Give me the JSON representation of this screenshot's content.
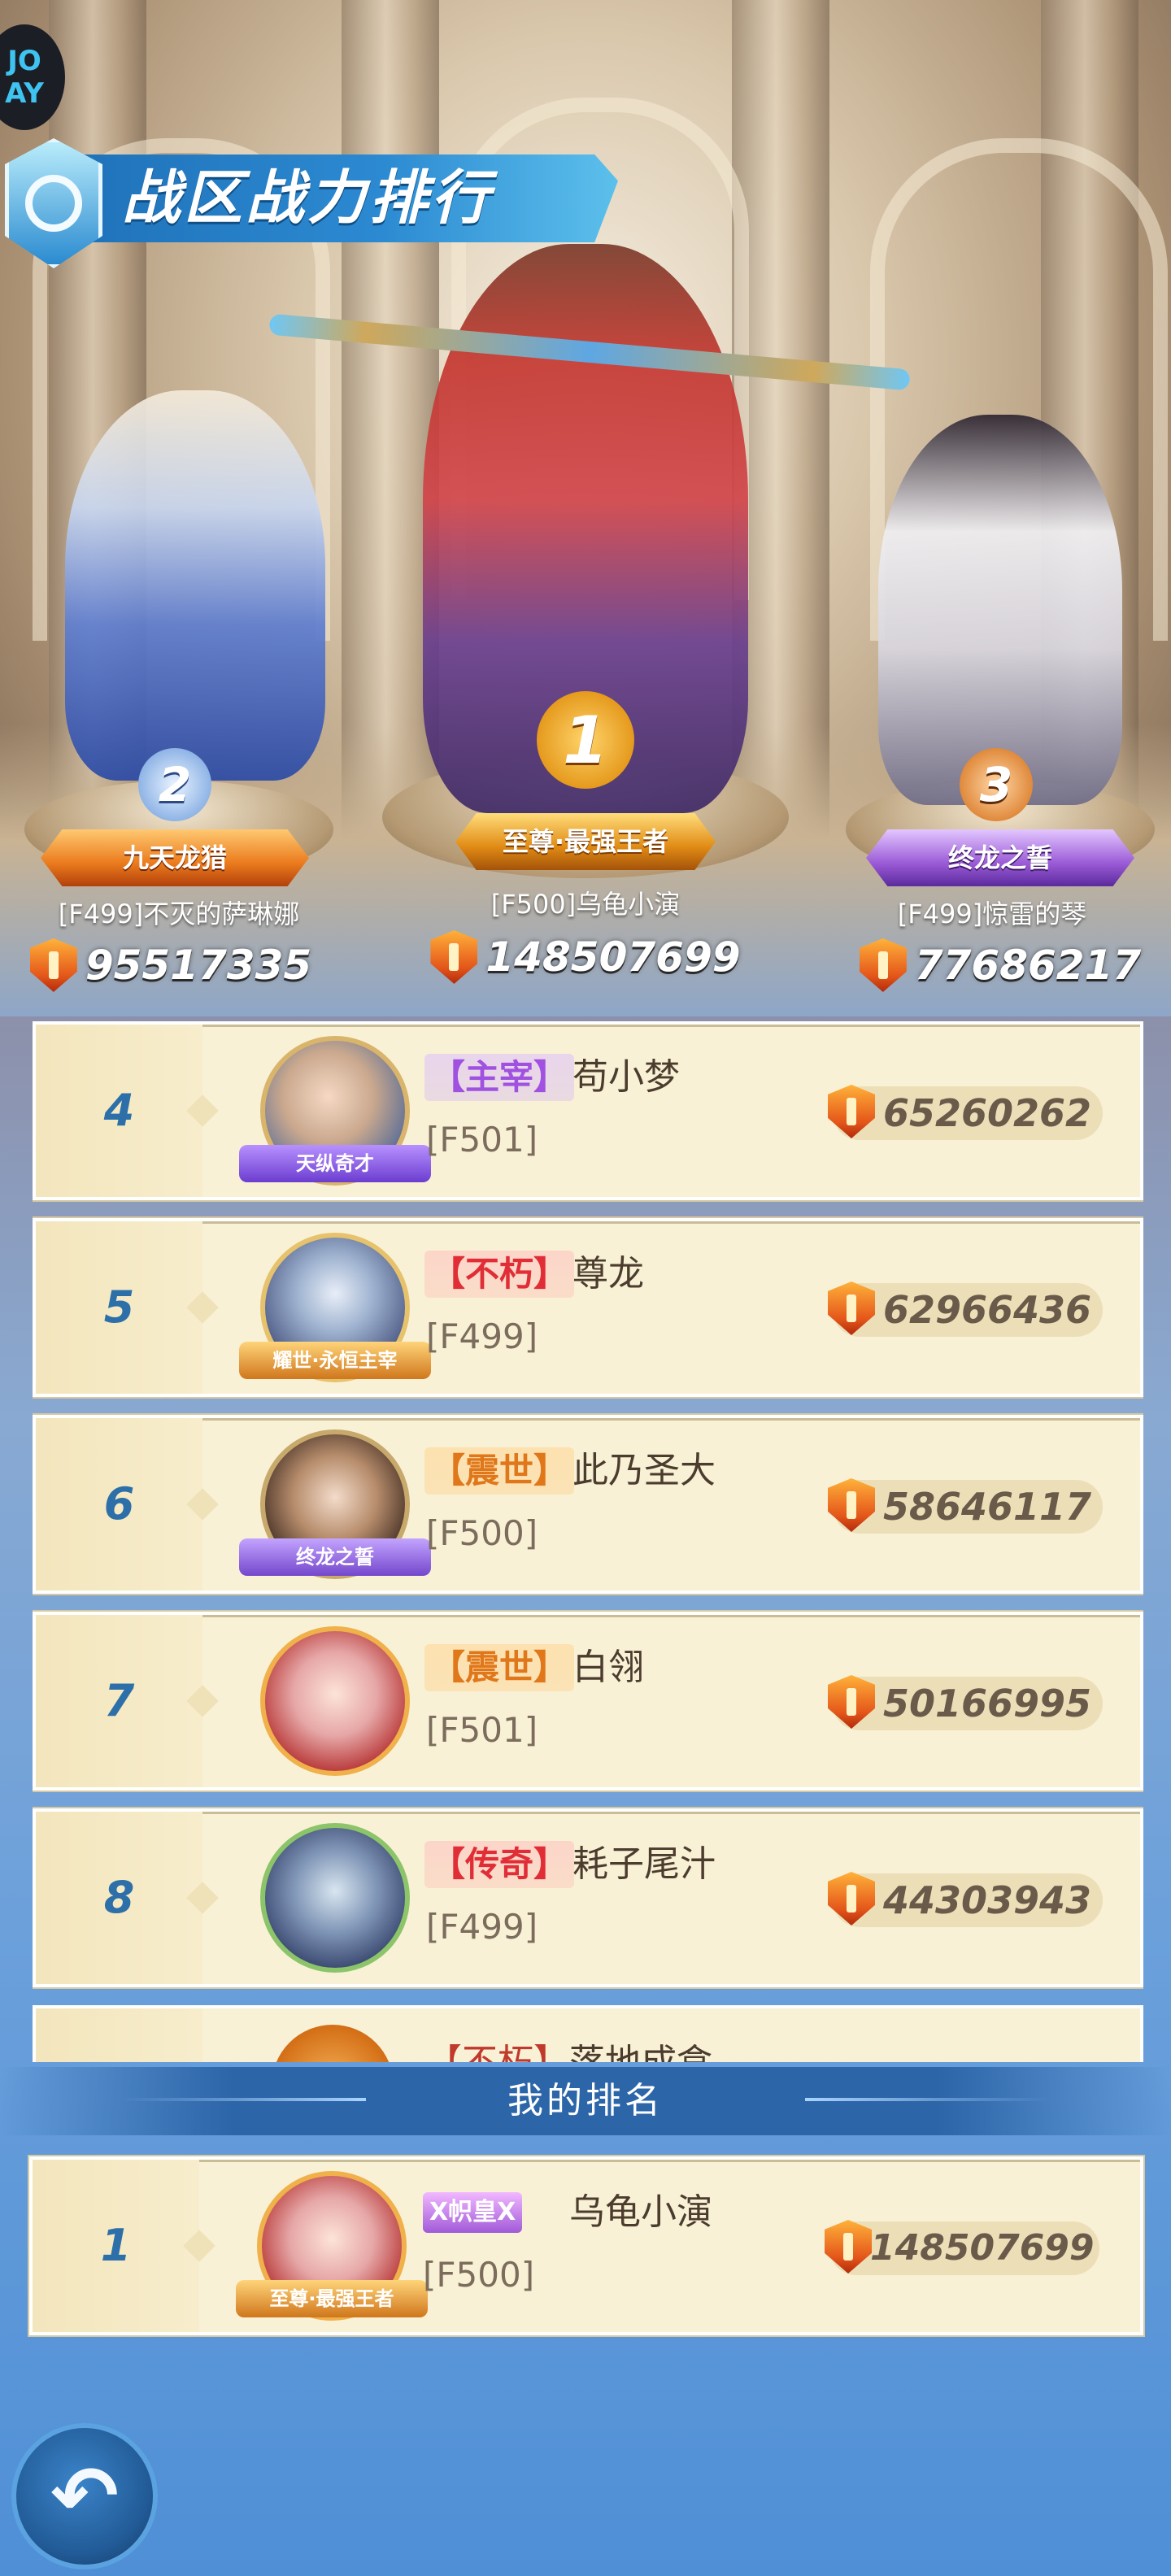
{
  "header": {
    "logo_line1": "JO",
    "logo_line2": "AY",
    "title": "战区战力排行"
  },
  "podium": [
    {
      "rank": "1",
      "title": "至尊·最强王者",
      "name": "[F500]乌龟小演",
      "power": "148507699"
    },
    {
      "rank": "2",
      "title": "九天龙猎",
      "name": "[F499]不灭的萨琳娜",
      "power": "95517335"
    },
    {
      "rank": "3",
      "title": "终龙之誓",
      "name": "[F499]惊雷的琴",
      "power": "77686217"
    }
  ],
  "rankings": [
    {
      "rank": "4",
      "tag": "【主宰】",
      "name": "苟小梦",
      "server": "[F501]",
      "power": "65260262",
      "badge": "天纵奇才"
    },
    {
      "rank": "5",
      "tag": "【不朽】",
      "name": "尊龙",
      "server": "[F499]",
      "power": "62966436",
      "badge": "耀世·永恒主宰"
    },
    {
      "rank": "6",
      "tag": "【震世】",
      "name": "此乃圣大",
      "server": "[F500]",
      "power": "58646117",
      "badge": "终龙之誓"
    },
    {
      "rank": "7",
      "tag": "【震世】",
      "name": "白翎",
      "server": "[F501]",
      "power": "50166995",
      "badge": ""
    },
    {
      "rank": "8",
      "tag": "【传奇】",
      "name": "耗子尾汁",
      "server": "[F499]",
      "power": "44303943",
      "badge": ""
    },
    {
      "rank": "",
      "tag": "【不朽】",
      "name": "落地成盒",
      "server": "",
      "power": "",
      "badge": ""
    }
  ],
  "my_rank": {
    "header": "我的排名",
    "rank": "1",
    "tag": "X帜皇X",
    "name": "乌龟小演",
    "server": "[F500]",
    "power": "148507699",
    "badge": "至尊·最强王者"
  },
  "colors": {
    "accent": "#2c65a8",
    "row_bg": "#f8f1d6",
    "rank_number": "#2d6fa8",
    "power_text": "#6a5a4a"
  },
  "icons": [
    "shield-power-icon",
    "back-arrow-icon",
    "rank-medal-icon"
  ]
}
